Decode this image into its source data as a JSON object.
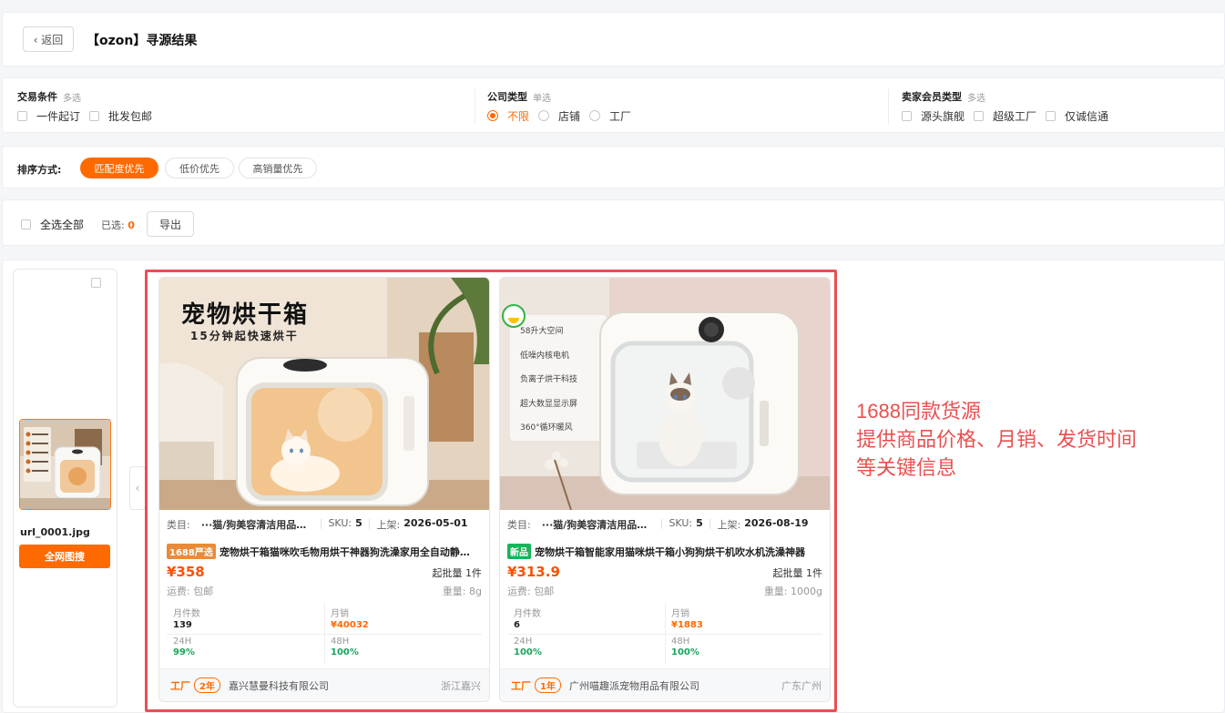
{
  "header": {
    "back_label": "‹ 返回",
    "title": "【ozon】寻源结果"
  },
  "filters": {
    "trade": {
      "title": "交易条件",
      "mode": "多选",
      "options": [
        "一件起订",
        "批发包邮"
      ]
    },
    "company": {
      "title": "公司类型",
      "mode": "单选",
      "options": [
        "不限",
        "店铺",
        "工厂"
      ],
      "selected": "不限"
    },
    "member": {
      "title": "卖家会员类型",
      "mode": "多选",
      "options": [
        "源头旗舰",
        "超级工厂",
        "仅诚信通"
      ]
    }
  },
  "sort": {
    "label": "排序方式:",
    "options": [
      "匹配度优先",
      "低价优先",
      "高销量优先"
    ],
    "active": "匹配度优先"
  },
  "selection": {
    "select_all": "全选全部",
    "selected_label": "已选:",
    "selected_count": "0",
    "export_label": "导出"
  },
  "source": {
    "filename": "url_0001.jpg",
    "search_button": "全网图搜"
  },
  "products": [
    {
      "image_text": {
        "headline": "宠物烘干箱",
        "subline": "15分钟起快速烘干"
      },
      "category_label": "类目:",
      "category": "···猫/狗美容清洁用品>宠物烘干箱",
      "sku_label": "SKU:",
      "sku": "5",
      "listed_label": "上架:",
      "listed": "2026-05-01",
      "tag": "1688严选",
      "title": "宠物烘干箱猫咪吹毛物用烘干神器狗洗澡家用全自动静音烘干机",
      "price": "¥358",
      "moq": "起批量 1件",
      "shipping": "运费: 包邮",
      "weight": "重量: 8g",
      "stats": [
        {
          "label": "月件数",
          "value": "139"
        },
        {
          "label": "月销",
          "value": "¥40032"
        },
        {
          "label": "24H",
          "value": "99%"
        },
        {
          "label": "48H",
          "value": "100%"
        }
      ],
      "supplier_type": "工厂",
      "supplier_years": "2年",
      "supplier_name": "嘉兴慧曼科技有限公司",
      "supplier_location": "浙江嘉兴"
    },
    {
      "image_text": {
        "features": [
          "58升大空间",
          "低噪内核电机",
          "负离子烘干科技",
          "超大数显显示屏",
          "360°循环暖风"
        ]
      },
      "category_label": "类目:",
      "category": "···猫/狗美容清洁用品>宠物烘干箱",
      "sku_label": "SKU:",
      "sku": "5",
      "listed_label": "上架:",
      "listed": "2026-08-19",
      "tag": "新品",
      "title": "宠物烘干箱智能家用猫咪烘干箱小狗狗烘干机吹水机洗澡神器",
      "price": "¥313.9",
      "moq": "起批量 1件",
      "shipping": "运费: 包邮",
      "weight": "重量: 1000g",
      "stats": [
        {
          "label": "月件数",
          "value": "6"
        },
        {
          "label": "月销",
          "value": "¥1883"
        },
        {
          "label": "24H",
          "value": "100%"
        },
        {
          "label": "48H",
          "value": "100%"
        }
      ],
      "supplier_type": "工厂",
      "supplier_years": "1年",
      "supplier_name": "广州喵趣派宠物用品有限公司",
      "supplier_location": "广东广州"
    }
  ],
  "annotation": {
    "line1": "1688同款货源",
    "line2": "提供商品价格、月销、发货时间",
    "line3": "等关键信息"
  },
  "colors": {
    "accent": "#ff6a00",
    "price": "#ff5000",
    "highlight_border": "#e84f55",
    "success": "#17a35b"
  }
}
